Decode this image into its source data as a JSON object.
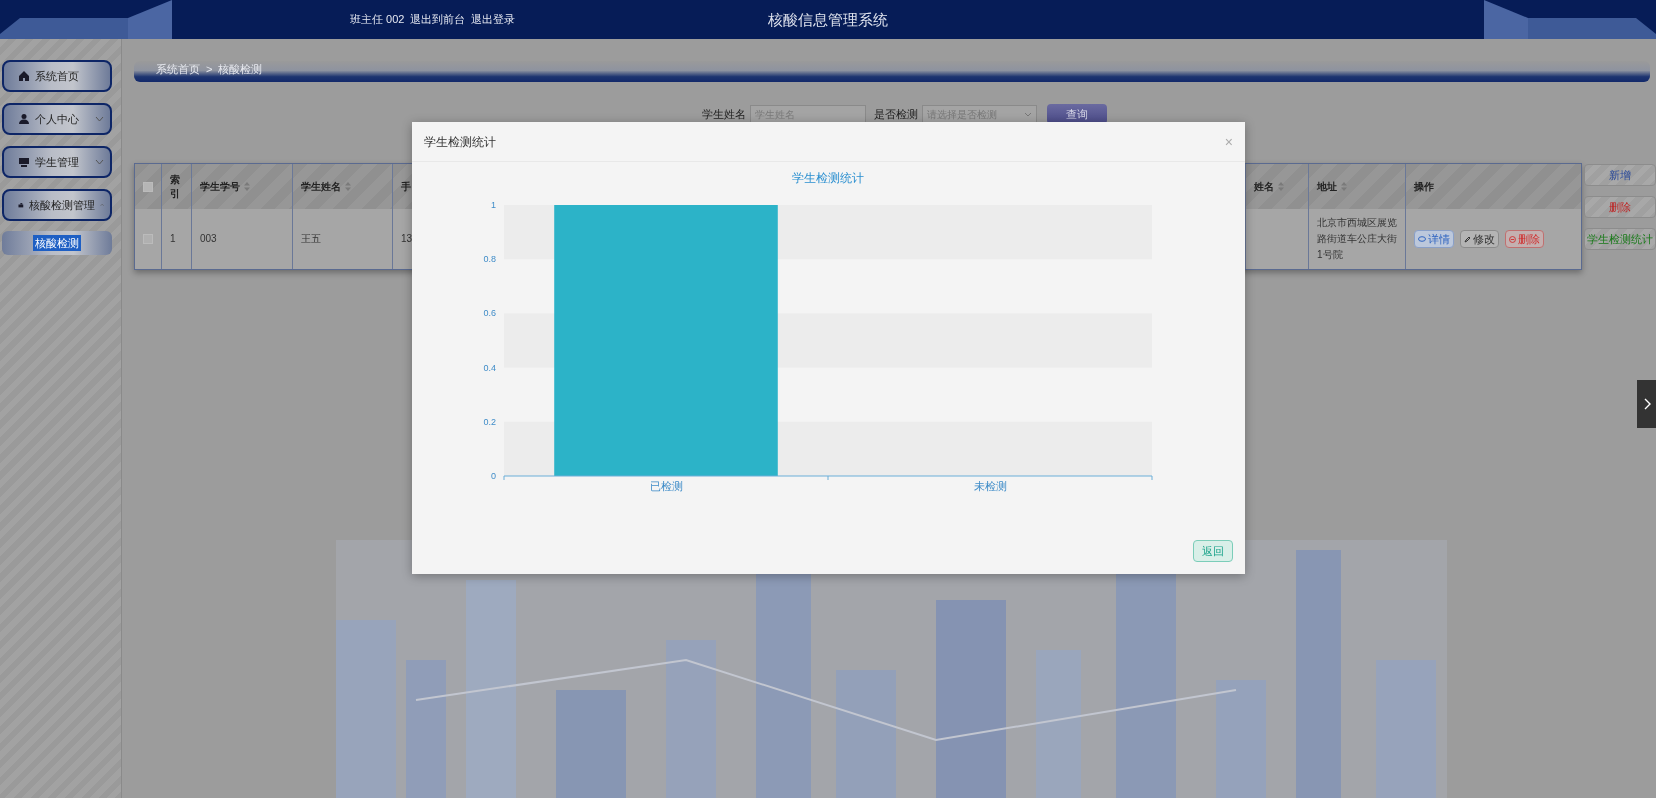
{
  "header": {
    "links": [
      "班主任 002",
      "退出到前台",
      "退出登录"
    ],
    "title": "核酸信息管理系统"
  },
  "sidebar": {
    "items": [
      {
        "label": "系统首页",
        "kind": "link"
      },
      {
        "label": "个人中心",
        "kind": "menu",
        "expanded": false
      },
      {
        "label": "学生管理",
        "kind": "menu",
        "expanded": false
      },
      {
        "label": "核酸检测管理",
        "kind": "menu",
        "expanded": true,
        "children": [
          {
            "label": "核酸检测",
            "selected": true
          }
        ]
      }
    ]
  },
  "breadcrumb": {
    "items": [
      "系统首页",
      "核酸检测"
    ],
    "separator": ">"
  },
  "search": {
    "fields": [
      {
        "label": "学生姓名",
        "placeholder": "学生姓名",
        "kind": "input"
      },
      {
        "label": "是否检测",
        "placeholder": "请选择是否检测",
        "kind": "select"
      }
    ],
    "button": "查询"
  },
  "table": {
    "all_checked": false,
    "columns": [
      {
        "kind": "checkbox"
      },
      {
        "label": "索引",
        "kind": "text",
        "sortable": false
      },
      {
        "label": "学生学号",
        "kind": "text",
        "sortable": true
      },
      {
        "label": "学生姓名",
        "kind": "text",
        "sortable": true
      },
      {
        "label": "手",
        "kind": "text",
        "sortable": false
      },
      {
        "label": "姓名",
        "kind": "text",
        "sortable": true
      },
      {
        "label": "地址",
        "kind": "text",
        "sortable": true
      },
      {
        "label": "操作",
        "kind": "actions",
        "sortable": false
      }
    ],
    "rows": [
      {
        "checked": false,
        "cells": [
          "",
          "1",
          "003",
          "王五",
          "13",
          "",
          "北京市西城区展览路街道车公庄大街1号院",
          ""
        ],
        "actions": [
          {
            "label": "详情",
            "kind": "view"
          },
          {
            "label": "修改",
            "kind": "edit"
          },
          {
            "label": "删除",
            "kind": "delete"
          }
        ]
      }
    ]
  },
  "side_buttons": [
    {
      "label": "新增",
      "kind": "add"
    },
    {
      "label": "删除",
      "kind": "delete"
    },
    {
      "label": "学生检测统计",
      "kind": "stats"
    }
  ],
  "dialog": {
    "title": "学生检测统计",
    "close": "×",
    "button": "返回",
    "chart_data": {
      "type": "bar",
      "title": "学生检测统计",
      "categories": [
        "已检测",
        "未检测"
      ],
      "values": [
        1,
        0
      ],
      "ylim": [
        0,
        1
      ],
      "yticks": [
        0,
        0.2,
        0.4,
        0.6,
        0.8,
        1
      ]
    }
  }
}
